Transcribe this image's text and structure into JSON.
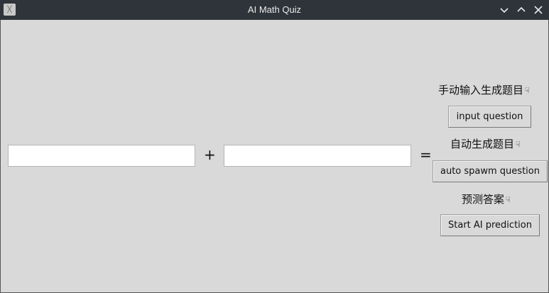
{
  "window": {
    "title": "AI Math Quiz",
    "app_icon": "tk-feather-icon",
    "titlebar_buttons": [
      "minimize-icon",
      "maximize-icon",
      "close-icon"
    ]
  },
  "equation": {
    "operand1_value": "",
    "operator": "+",
    "operand2_value": "",
    "equals": "="
  },
  "panel": {
    "manual_label": "手动输入生成题目",
    "manual_button": "input question",
    "auto_label": "自动生成题目",
    "auto_button": "auto spawm question",
    "predict_label": "预测答案",
    "predict_button": "Start AI prediction",
    "hand_icon_glyph": "☟"
  }
}
